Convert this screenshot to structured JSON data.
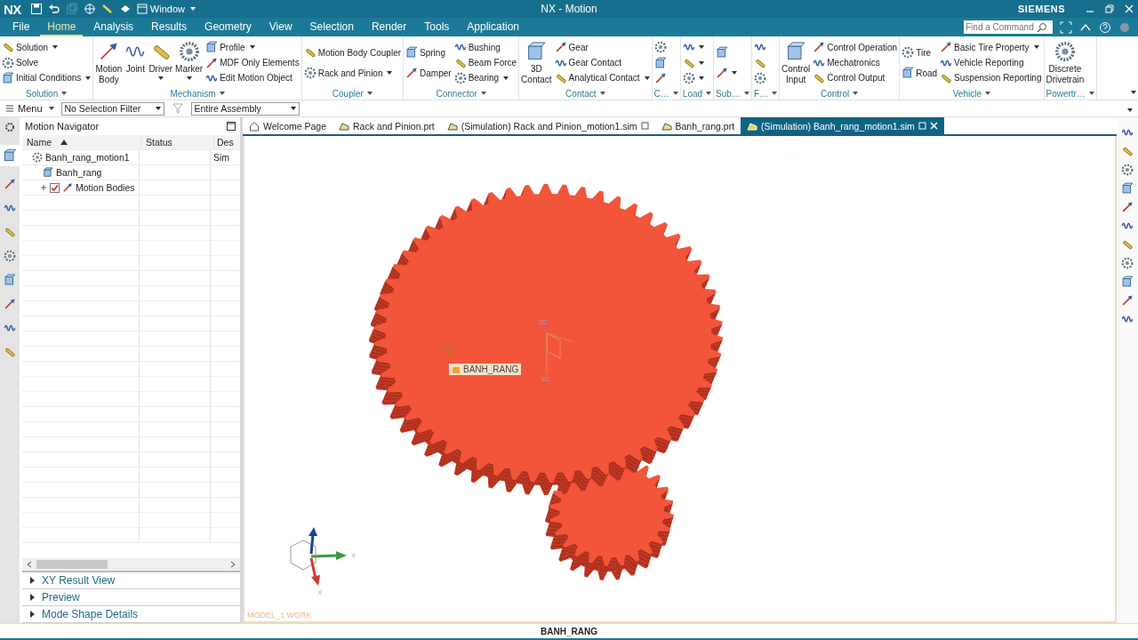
{
  "window": {
    "logo": "NX",
    "title": "NX - Motion",
    "brand": "SIEMENS",
    "window_menu": "Window"
  },
  "menu_tabs": [
    {
      "label": "File",
      "selected": false
    },
    {
      "label": "Home",
      "selected": true
    },
    {
      "label": "Analysis",
      "selected": false
    },
    {
      "label": "Results",
      "selected": false
    },
    {
      "label": "Geometry",
      "selected": false
    },
    {
      "label": "View",
      "selected": false
    },
    {
      "label": "Selection",
      "selected": false
    },
    {
      "label": "Render",
      "selected": false
    },
    {
      "label": "Tools",
      "selected": false
    },
    {
      "label": "Application",
      "selected": false
    }
  ],
  "command_search": {
    "placeholder": "Find a Command"
  },
  "ribbon_groups": [
    {
      "label": "Solution",
      "columns": [
        [
          {
            "label": "Solution",
            "kind": "small",
            "dropdown": true
          },
          {
            "label": "Solve",
            "kind": "small"
          },
          {
            "label": "Initial Conditions",
            "kind": "small",
            "dropdown": true
          }
        ]
      ]
    },
    {
      "label": "Mechanism",
      "columns": [
        [
          {
            "label": "Motion Body",
            "kind": "large"
          }
        ],
        [
          {
            "label": "Joint",
            "kind": "large"
          }
        ],
        [
          {
            "label": "Driver",
            "kind": "large",
            "dropdown": true
          }
        ],
        [
          {
            "label": "Marker",
            "kind": "large",
            "dropdown": true
          }
        ],
        [
          {
            "label": "Profile",
            "kind": "small",
            "dropdown": true
          },
          {
            "label": "MDF Only Elements",
            "kind": "small"
          },
          {
            "label": "Edit Motion Object",
            "kind": "small"
          }
        ]
      ]
    },
    {
      "label": "Coupler",
      "columns": [
        [
          {
            "label": "Motion Body Coupler",
            "kind": "small"
          },
          {
            "label": "Rack and Pinion",
            "kind": "small",
            "dropdown": true
          }
        ]
      ]
    },
    {
      "label": "Connector",
      "columns": [
        [
          {
            "label": "Spring",
            "kind": "small"
          },
          {
            "label": "Damper",
            "kind": "small"
          }
        ],
        [
          {
            "label": "Bushing",
            "kind": "small"
          },
          {
            "label": "Beam Force",
            "kind": "small"
          },
          {
            "label": "Bearing",
            "kind": "small",
            "dropdown": true
          }
        ]
      ]
    },
    {
      "label": "Contact",
      "columns": [
        [
          {
            "label": "3D Contact",
            "kind": "large"
          }
        ],
        [
          {
            "label": "Gear",
            "kind": "small"
          },
          {
            "label": "Gear Contact",
            "kind": "small"
          },
          {
            "label": "Analytical Contact",
            "kind": "small",
            "dropdown": true
          }
        ]
      ]
    },
    {
      "label": "C…",
      "columns": [
        [
          {
            "kind": "icon"
          },
          {
            "kind": "icon"
          },
          {
            "kind": "icon"
          }
        ]
      ]
    },
    {
      "label": "Load",
      "columns": [
        [
          {
            "kind": "icon",
            "dropdown": true
          },
          {
            "kind": "icon",
            "dropdown": true
          },
          {
            "kind": "icon",
            "dropdown": true
          }
        ]
      ]
    },
    {
      "label": "Sub…",
      "columns": [
        [
          {
            "kind": "icon"
          },
          {
            "kind": "icon",
            "dropdown": true
          }
        ]
      ]
    },
    {
      "label": "F…",
      "columns": [
        [
          {
            "kind": "icon"
          },
          {
            "kind": "icon"
          },
          {
            "kind": "icon"
          }
        ]
      ]
    },
    {
      "label": "Control",
      "columns": [
        [
          {
            "label": "Control Input",
            "kind": "large"
          }
        ],
        [
          {
            "label": "Control Operation",
            "kind": "small"
          },
          {
            "label": "Mechatronics",
            "kind": "small"
          },
          {
            "label": "Control Output",
            "kind": "small"
          }
        ]
      ]
    },
    {
      "label": "Vehicle",
      "columns": [
        [
          {
            "label": "Tire",
            "kind": "small"
          },
          {
            "label": "Road",
            "kind": "small"
          }
        ],
        [
          {
            "label": "Basic Tire Property",
            "kind": "small",
            "dropdown": true
          },
          {
            "label": "Vehicle Reporting",
            "kind": "small"
          },
          {
            "label": "Suspension Reporting",
            "kind": "small"
          }
        ]
      ]
    },
    {
      "label": "Powertr…",
      "columns": [
        [
          {
            "label": "Discrete Drivetrain",
            "kind": "large"
          }
        ]
      ]
    }
  ],
  "selection_bar": {
    "menu": "Menu",
    "selection_filter": "No Selection Filter",
    "assembly_scope": "Entire Assembly"
  },
  "navigator": {
    "title": "Motion Navigator",
    "columns": [
      {
        "label": "Name",
        "sorted": true
      },
      {
        "label": "Status"
      },
      {
        "label": "Des"
      }
    ],
    "rows": [
      {
        "name": "Banh_rang_motion1",
        "description": "Sim",
        "children": [
          {
            "name": "Banh_rang"
          },
          {
            "name": "Motion Bodies",
            "expanded": false,
            "checked": true
          }
        ]
      }
    ]
  },
  "panels": [
    {
      "label": "XY Result View",
      "expanded": false
    },
    {
      "label": "Preview",
      "expanded": false
    },
    {
      "label": "Mode Shape Details",
      "expanded": false
    }
  ],
  "doc_tabs": [
    {
      "label": "Welcome Page",
      "selected": false
    },
    {
      "label": "Rack and Pinion.prt",
      "selected": false
    },
    {
      "label": "(Simulation) Rack and Pinion_motion1.sim",
      "selected": false
    },
    {
      "label": "Banh_rang.prt",
      "selected": false
    },
    {
      "label": "(Simulation) Banh_rang_motion1.sim",
      "selected": true
    }
  ],
  "viewport": {
    "selection_label": "BANH_RANG",
    "wcs": {
      "z_label": "ZC",
      "x_label": "XC"
    },
    "triad": {
      "y_label": "Y",
      "x_label": "X"
    },
    "work_part": "MODEL_1 WORK"
  },
  "status_bar": {
    "text": "BANH_RANG"
  }
}
